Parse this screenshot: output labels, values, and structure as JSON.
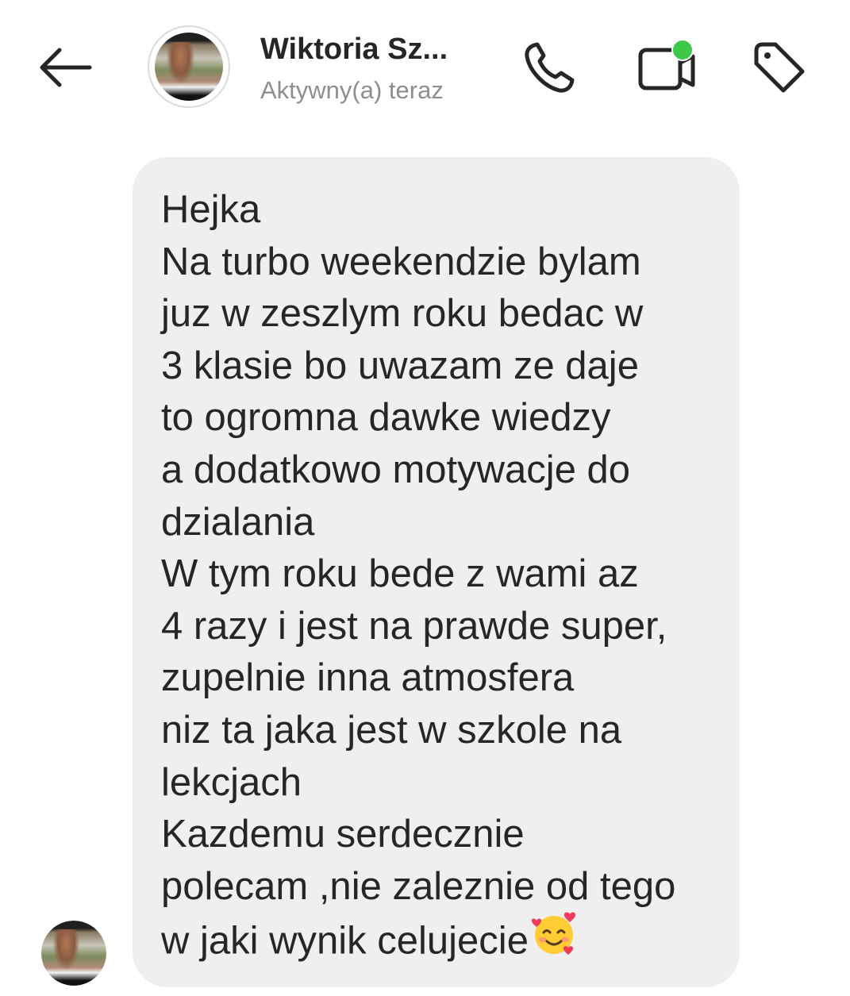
{
  "header": {
    "contact_name": "Wiktoria Sz...",
    "status": "Aktywny(a) teraz",
    "icons": {
      "back": "arrow-left-icon",
      "call": "phone-icon",
      "video": "video-camera-icon",
      "tag": "tag-icon"
    },
    "online_indicator_color": "#3ec84a"
  },
  "message": {
    "lines": [
      "Hejka",
      "Na turbo weekendzie bylam",
      "juz w zeszlym roku bedac w",
      "3 klasie bo uwazam ze daje",
      "to ogromna dawke wiedzy",
      "a dodatkowo motywacje do",
      "dzialania",
      "W tym roku bede z wami az",
      "4 razy i jest na prawde super,",
      "zupelnie inna atmosfera",
      "niz ta jaka jest w szkole na",
      "lekcjach",
      "Kazdemu serdecznie",
      "polecam ,nie zaleznie od tego",
      "w jaki wynik celujecie"
    ],
    "trailing_emoji": "smiling-face-with-hearts-emoji",
    "bubble_color": "#efefef"
  }
}
